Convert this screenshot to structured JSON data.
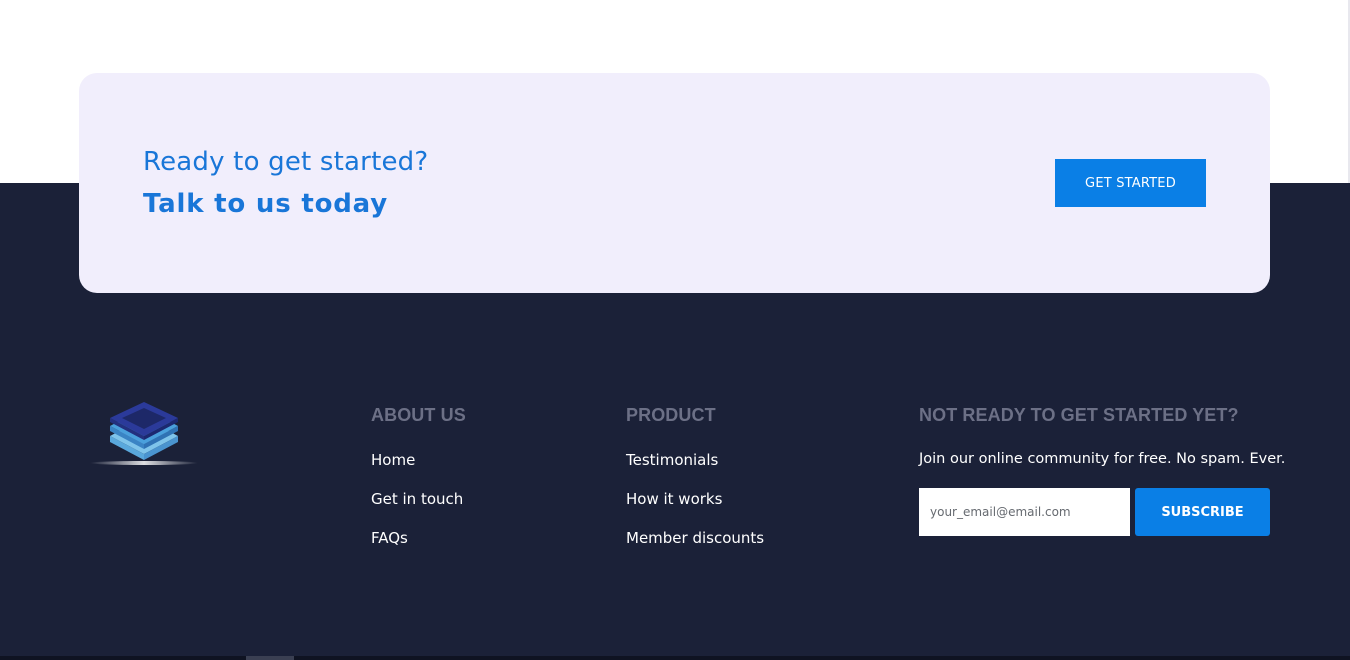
{
  "cta": {
    "line1": "Ready to get started?",
    "line2": "Talk to us today",
    "button_label": "GET STARTED"
  },
  "logo": {
    "icon": "stacked-layers-logo"
  },
  "columns": {
    "about": {
      "heading": "ABOUT US",
      "links": [
        "Home",
        "Get in touch",
        "FAQs"
      ]
    },
    "product": {
      "heading": "PRODUCT",
      "links": [
        "Testimonials",
        "How it works",
        "Member discounts"
      ]
    },
    "newsletter": {
      "heading": "NOT READY TO GET STARTED YET?",
      "text": "Join our online community for free. No spam. Ever.",
      "email_placeholder": "your_email@email.com",
      "button_label": "SUBSCRIBE"
    }
  },
  "colors": {
    "accent": "#0a7fe6",
    "footer_bg": "#1b2138",
    "card_bg": "#f1eefc",
    "heading_muted": "#6c7086"
  }
}
